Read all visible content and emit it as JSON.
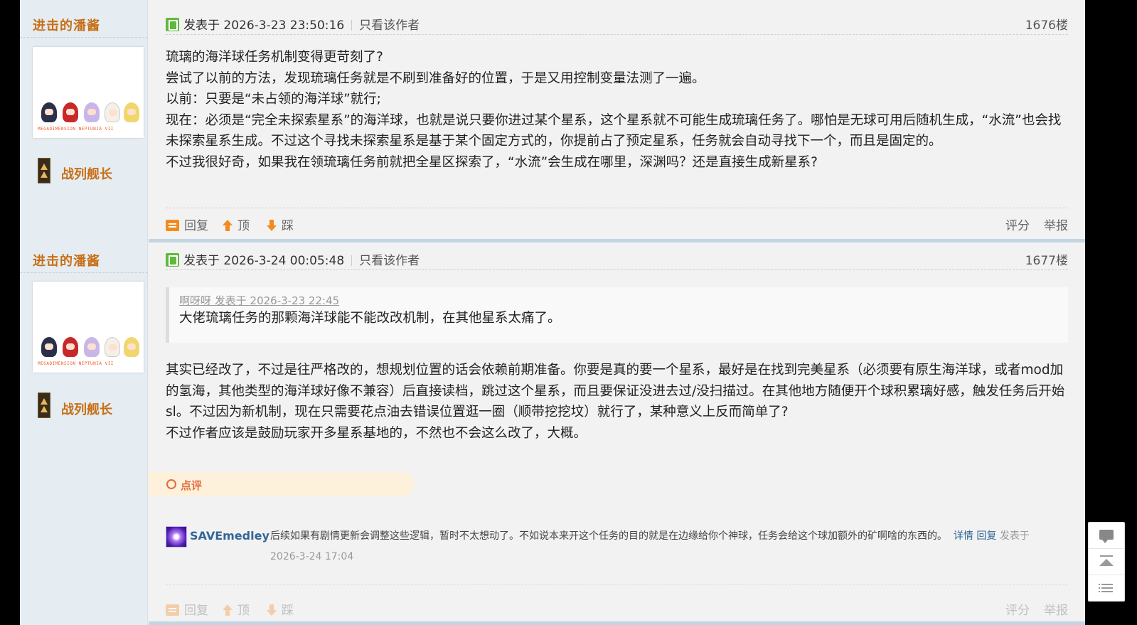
{
  "posts": [
    {
      "username": "进击的潘酱",
      "avatar_caption": "MEGADIMENSION NEPTUNIA VII",
      "rank": "战列舰长",
      "posted_at": "发表于 2026-3-23 23:50:16",
      "author_only": "只看该作者",
      "floor": "1676楼",
      "content": [
        "琉璃的海洋球任务机制变得更苛刻了?",
        "尝试了以前的方法，发现琉璃任务就是不刷到准备好的位置，于是又用控制变量法测了一遍。",
        "以前：只要是“未占领的海洋球”就行;",
        "现在：必须是“完全未探索星系”的海洋球，也就是说只要你进过某个星系，这个星系就不可能生成琉璃任务了。哪怕是无球可用后随机生成，“水流”也会找未探索星系生成。不过这个寻找未探索星系是基于某个固定方式的，你提前占了预定星系，任务就会自动寻找下一个，而且是固定的。",
        "不过我很好奇，如果我在领琉璃任务前就把全星区探索了，“水流”会生成在哪里，深渊吗？还是直接生成新星系?"
      ],
      "actions": {
        "reply": "回复",
        "up": "顶",
        "down": "踩",
        "rate": "评分",
        "report": "举报"
      }
    },
    {
      "username": "进击的潘酱",
      "avatar_caption": "MEGADIMENSION NEPTUNIA VII",
      "rank": "战列舰长",
      "posted_at": "发表于 2026-3-24 00:05:48",
      "author_only": "只看该作者",
      "floor": "1677楼",
      "quote": {
        "header": "啊呀呀 发表于 2026-3-23 22:45",
        "text": "大佬琉璃任务的那颗海洋球能不能改改机制，在其他星系太痛了。"
      },
      "content": [
        "其实已经改了，不过是往严格改的，想规划位置的话会依赖前期准备。你要是真的要一个星系，最好是在找到完美星系（必须要有原生海洋球，或者mod加的氢海，其他类型的海洋球好像不兼容）后直接读档，跳过这个星系，而且要保证没进去过/没扫描过。在其他地方随便开个球积累璃好感，触发任务后开始sl。不过因为新机制，现在只需要花点油去错误位置逛一圈（顺带挖挖坟）就行了，某种意义上反而简单了?",
        "不过作者应该是鼓励玩家开多星系基地的，不然也不会这么改了，大概。"
      ],
      "dianping_label": "点评",
      "comment": {
        "user": "SAVEmedley",
        "text": "后续如果有剧情更新会调整这些逻辑，暂时不太想动了。不如说本来开这个任务的目的就是在边缘给你个神球，任务会给这个球加额外的矿啊啥的东西的。",
        "detail_link": "详情",
        "reply_link": "回复",
        "time": "发表于 2026-3-24 17:04"
      },
      "actions": {
        "reply": "回复",
        "up": "顶",
        "down": "踩",
        "rate": "评分",
        "report": "举报"
      }
    }
  ],
  "colors": {
    "username": "#c86f17",
    "link": "#336699",
    "action_icon": "#f28b1d",
    "sidebar_bg": "#e5edf2",
    "divider": "#c2d5e3"
  },
  "float_tools": [
    "chat-icon",
    "back-to-top-icon",
    "list-icon"
  ]
}
